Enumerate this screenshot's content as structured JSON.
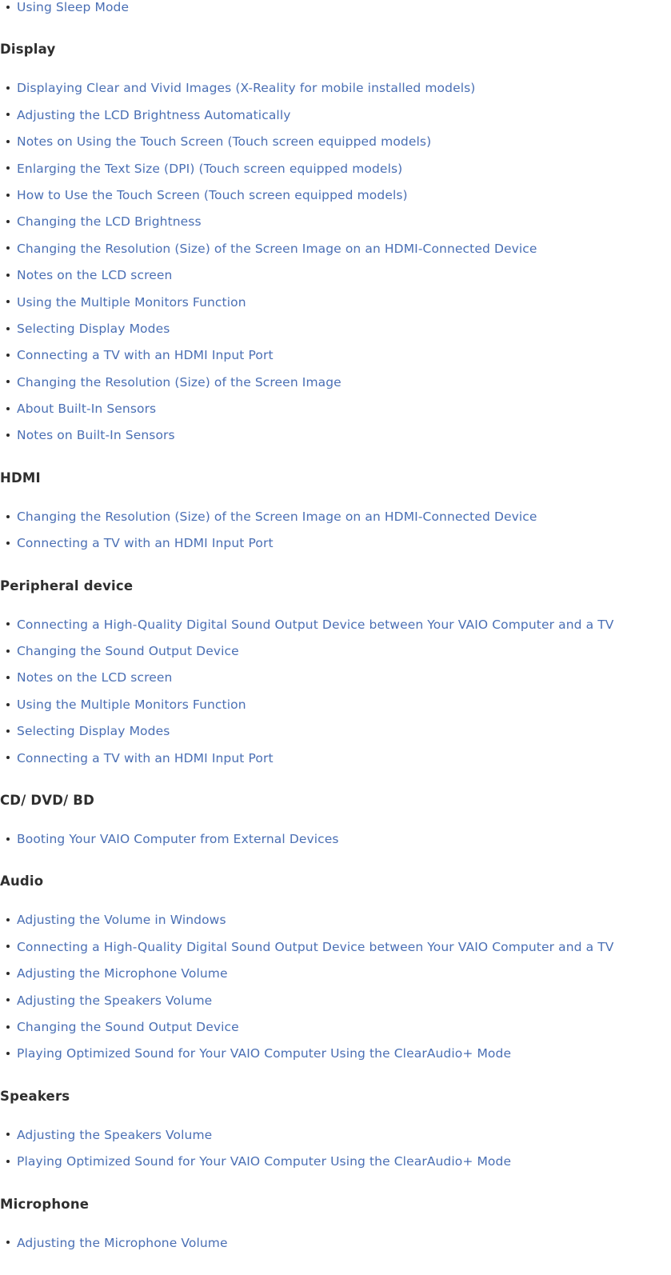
{
  "document": {
    "type": "help-topic-index",
    "link_color": "#4a6fb4",
    "heading_color": "#2e2e2e",
    "bullet_color": "#2b2b2b",
    "background_color": "#ffffff"
  },
  "leading_items": [
    {
      "label": "Using Sleep Mode"
    }
  ],
  "sections": [
    {
      "heading": "Display",
      "items": [
        {
          "label": "Displaying Clear and Vivid Images (X-Reality for mobile installed models)"
        },
        {
          "label": "Adjusting the LCD Brightness Automatically"
        },
        {
          "label": "Notes on Using the Touch Screen (Touch screen equipped models)"
        },
        {
          "label": "Enlarging the Text Size (DPI) (Touch screen equipped models)"
        },
        {
          "label": "How to Use the Touch Screen (Touch screen equipped models)"
        },
        {
          "label": "Changing the LCD Brightness"
        },
        {
          "label": "Changing the Resolution (Size) of the Screen Image on an HDMI-Connected Device"
        },
        {
          "label": "Notes on the LCD screen"
        },
        {
          "label": "Using the Multiple Monitors Function"
        },
        {
          "label": "Selecting Display Modes"
        },
        {
          "label": "Connecting a TV with an HDMI Input Port"
        },
        {
          "label": "Changing the Resolution (Size) of the Screen Image"
        },
        {
          "label": "About Built-In Sensors"
        },
        {
          "label": "Notes on Built-In Sensors"
        }
      ]
    },
    {
      "heading": "HDMI",
      "items": [
        {
          "label": "Changing the Resolution (Size) of the Screen Image on an HDMI-Connected Device"
        },
        {
          "label": "Connecting a TV with an HDMI Input Port"
        }
      ]
    },
    {
      "heading": "Peripheral device",
      "items": [
        {
          "label": "Connecting a High-Quality Digital Sound Output Device between Your VAIO Computer and a TV"
        },
        {
          "label": "Changing the Sound Output Device"
        },
        {
          "label": "Notes on the LCD screen"
        },
        {
          "label": "Using the Multiple Monitors Function"
        },
        {
          "label": "Selecting Display Modes"
        },
        {
          "label": "Connecting a TV with an HDMI Input Port"
        }
      ]
    },
    {
      "heading": "CD/ DVD/ BD",
      "items": [
        {
          "label": "Booting Your VAIO Computer from External Devices"
        }
      ]
    },
    {
      "heading": "Audio",
      "items": [
        {
          "label": "Adjusting the Volume in Windows"
        },
        {
          "label": "Connecting a High-Quality Digital Sound Output Device between Your VAIO Computer and a TV"
        },
        {
          "label": "Adjusting the Microphone Volume"
        },
        {
          "label": "Adjusting the Speakers Volume"
        },
        {
          "label": "Changing the Sound Output Device"
        },
        {
          "label": "Playing Optimized Sound for Your VAIO Computer Using the ClearAudio+ Mode"
        }
      ]
    },
    {
      "heading": "Speakers",
      "items": [
        {
          "label": "Adjusting the Speakers Volume"
        },
        {
          "label": "Playing Optimized Sound for Your VAIO Computer Using the ClearAudio+ Mode"
        }
      ]
    },
    {
      "heading": "Microphone",
      "items": [
        {
          "label": "Adjusting the Microphone Volume"
        }
      ]
    }
  ]
}
